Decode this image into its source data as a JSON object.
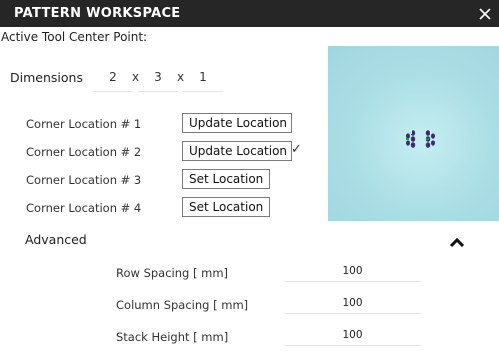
{
  "window": {
    "title": "PATTERN WORKSPACE",
    "subtitle": "Active Tool Center Point:"
  },
  "dimensions": {
    "label": "Dimensions",
    "x": "2",
    "y": "3",
    "z": "1",
    "separator": "x"
  },
  "corners": [
    {
      "label": "Corner Location # 1",
      "button": "Update Location",
      "checked": false
    },
    {
      "label": "Corner Location # 2",
      "button": "Update Location",
      "checked": true,
      "check_mark": "✓"
    },
    {
      "label": "Corner Location # 3",
      "button": "Set Location",
      "checked": false
    },
    {
      "label": "Corner Location # 4",
      "button": "Set Location",
      "checked": false
    }
  ],
  "preview": {
    "background": "#b4e6ec",
    "part_color": "#3d2a6b"
  },
  "advanced": {
    "label": "Advanced",
    "expanded": true,
    "fields": [
      {
        "label": "Row Spacing [ mm]",
        "value": "100"
      },
      {
        "label": "Column Spacing [ mm]",
        "value": "100"
      },
      {
        "label": "Stack Height [ mm]",
        "value": "100"
      }
    ]
  },
  "icons": {
    "close": "close-icon",
    "collapse": "chevron-up-icon"
  }
}
